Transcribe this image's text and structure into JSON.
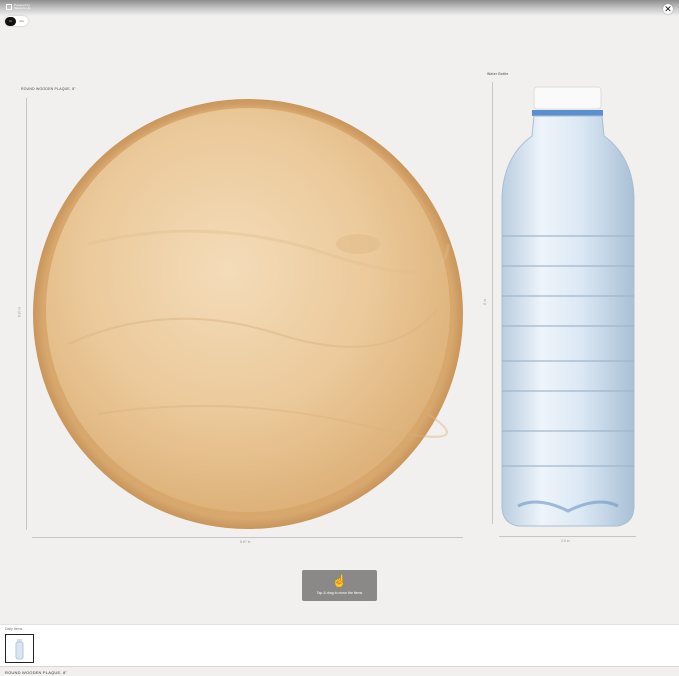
{
  "header": {
    "brand_line1": "Powered by",
    "brand_line2": "Measure Up",
    "close_symbol": "✕"
  },
  "units": {
    "options": [
      "in",
      "cm"
    ],
    "selected": "in"
  },
  "items": [
    {
      "name": "ROUND WOODEN PLAQUE, 8\"",
      "width_label": "8.87 in",
      "height_label": "8.87 in"
    },
    {
      "name": "Water Bottle",
      "width_label": "2.5 in",
      "height_label": "8 in"
    }
  ],
  "hint": {
    "text": "Tap & drag to move the items"
  },
  "tray": {
    "label": "Daily Items"
  },
  "footer": {
    "title": "ROUND WOODEN PLAQUE, 8\""
  },
  "colors": {
    "background": "#f2f0ef",
    "accent": "#111111",
    "hint_box": "#8a8988"
  }
}
